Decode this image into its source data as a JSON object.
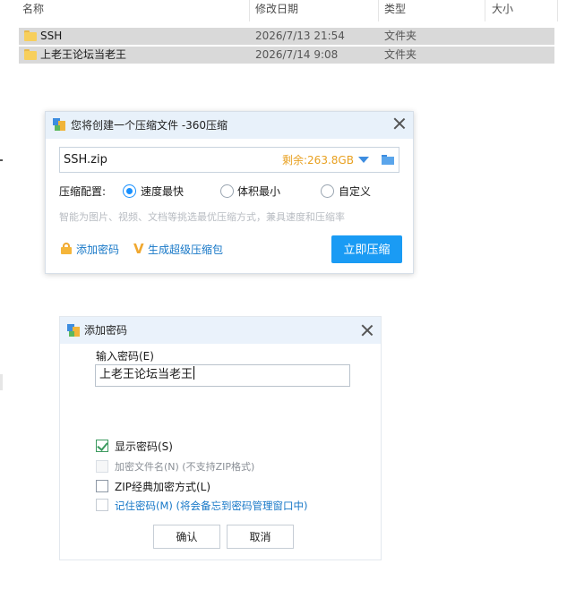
{
  "explorer": {
    "columns": {
      "name": "名称",
      "date": "修改日期",
      "type": "类型",
      "size": "大小"
    },
    "rows": [
      {
        "name": "SSH",
        "date": "2026/7/13 21:54",
        "type": "文件夹"
      },
      {
        "name": "上老王论坛当老王",
        "date": "2026/7/14 9:08",
        "type": "文件夹"
      }
    ]
  },
  "compress_dialog": {
    "title": "您将创建一个压缩文件 -360压缩",
    "filename": "SSH.zip",
    "remaining": "剩余:263.8GB",
    "config_label": "压缩配置:",
    "options": [
      "速度最快",
      "体积最小",
      "自定义"
    ],
    "selected_option": "速度最快",
    "hint": "智能为图片、视频、文档等挑选最优压缩方式，兼具速度和压缩率",
    "add_password": "添加密码",
    "super_package": "生成超级压缩包",
    "compress_button": "立即压缩"
  },
  "password_dialog": {
    "title": "添加密码",
    "input_label": "输入密码(E)",
    "password_value": "上老王论坛当老王",
    "show_password": "显示密码(S)",
    "encrypt_filenames": "加密文件名(N) (不支持ZIP格式)",
    "zip_classic": "ZIP经典加密方式(L)",
    "remember_password": "记住密码(M) (将会备忘到密码管理窗口中)",
    "ok": "确认",
    "cancel": "取消"
  },
  "colors": {
    "accent": "#1a9bf4",
    "remaining_orange": "#e8a020",
    "link_blue": "#1677c7",
    "selection_gray": "#d9d9d9"
  }
}
